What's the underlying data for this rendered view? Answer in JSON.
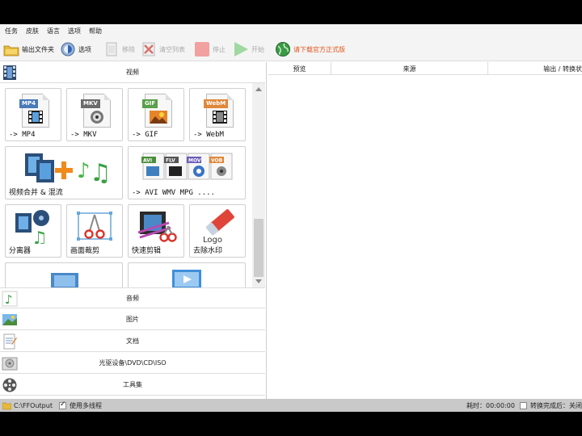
{
  "menu": [
    "任务",
    "皮肤",
    "语言",
    "选项",
    "帮助"
  ],
  "toolbar": {
    "output_folder": "输出文件夹",
    "options": "选项",
    "remove": "移除",
    "clear_list": "清空列表",
    "stop": "停止",
    "start": "开始",
    "download": "请下载官方正式版"
  },
  "left": {
    "video_header": "视频",
    "tiles": {
      "mp4": {
        "tag": "MP4",
        "label": "-> MP4"
      },
      "mkv": {
        "tag": "MKV",
        "label": "-> MKV"
      },
      "gif": {
        "tag": "GIF",
        "label": "-> GIF"
      },
      "webm": {
        "tag": "WebM",
        "label": "-> WebM"
      },
      "merge": {
        "label": "视频合并 & 混流"
      },
      "multi": {
        "label": "-> AVI WMV MPG ....",
        "tags": [
          "AVI",
          "FLV",
          "MOV",
          "VOB"
        ]
      },
      "separator": {
        "label": "分离器"
      },
      "crop": {
        "label": "画面裁剪"
      },
      "quickcut": {
        "label": "快速剪辑"
      },
      "watermark": {
        "label": "去除水印",
        "logo": "Logo"
      }
    },
    "categories": [
      "音频",
      "图片",
      "文档",
      "光驱设备\\DVD\\CD\\ISO",
      "工具集"
    ]
  },
  "right": {
    "columns": [
      "预览",
      "来源",
      "输出 / 转换状"
    ]
  },
  "status": {
    "path": "C:\\FFOutput",
    "multithread": "使用多线程",
    "elapsed": "耗时：00:00:00",
    "after_done": "转换完成后：关闭"
  },
  "colors": {
    "accent": "#e0561c",
    "green": "#3bb54a",
    "status_bar": "#c9c9c9"
  }
}
